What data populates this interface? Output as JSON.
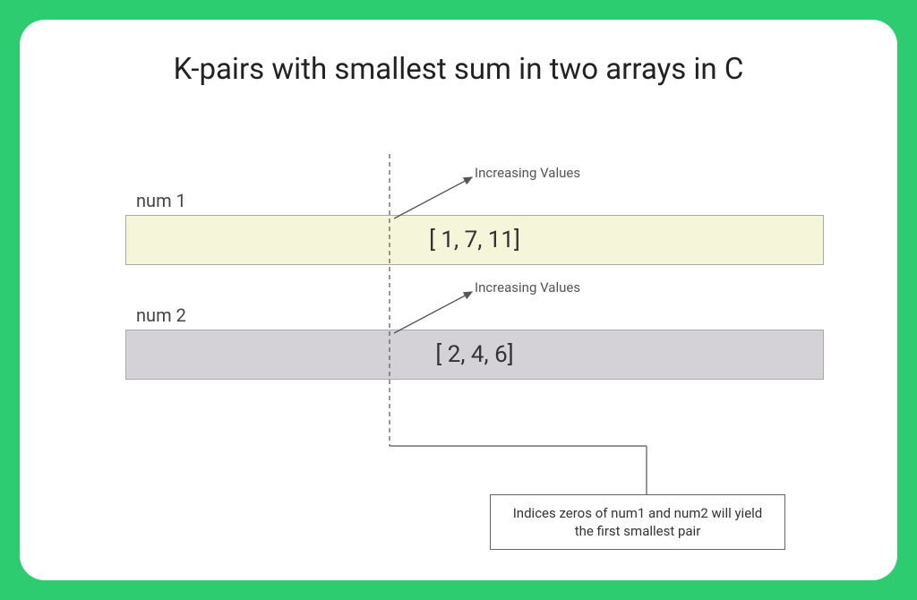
{
  "title": "K-pairs with smallest sum in two arrays in C",
  "arrays": {
    "label1": "num 1",
    "label2": "num 2",
    "content1": "[ 1, 7, 11]",
    "content2": "[ 2, 4, 6]"
  },
  "annotations": {
    "increasing1": "Increasing Values",
    "increasing2": "Increasing Values",
    "caption": "Indices zeros of num1 and num2 will yield the first smallest pair"
  },
  "colors": {
    "accent": "#2ecc71",
    "box1_bg": "#f5f5d9",
    "box2_bg": "#d4d2d6"
  }
}
